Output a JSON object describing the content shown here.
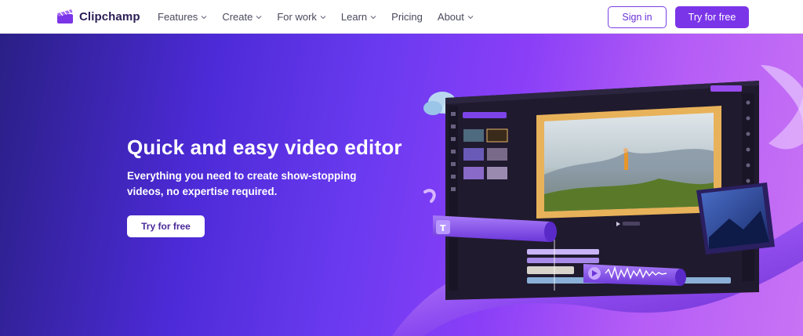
{
  "nav": {
    "brand": "Clipchamp",
    "items": [
      {
        "label": "Features",
        "has_dropdown": true
      },
      {
        "label": "Create",
        "has_dropdown": true
      },
      {
        "label": "For work",
        "has_dropdown": true
      },
      {
        "label": "Learn",
        "has_dropdown": true
      },
      {
        "label": "Pricing",
        "has_dropdown": false
      },
      {
        "label": "About",
        "has_dropdown": true
      }
    ],
    "sign_in": "Sign in",
    "try_free": "Try for free"
  },
  "hero": {
    "title": "Quick and easy video editor",
    "subtitle": "Everything you need to create show-stopping videos, no expertise required.",
    "cta": "Try for free"
  },
  "colors": {
    "brand": "#7b35e8",
    "brand_text": "#2a1d55",
    "hero_start": "#2a1f86",
    "hero_end": "#c873f5"
  },
  "icons": [
    "clipchamp-logo-icon",
    "chevron-down-icon",
    "play-icon",
    "text-icon",
    "audio-wave-icon"
  ]
}
